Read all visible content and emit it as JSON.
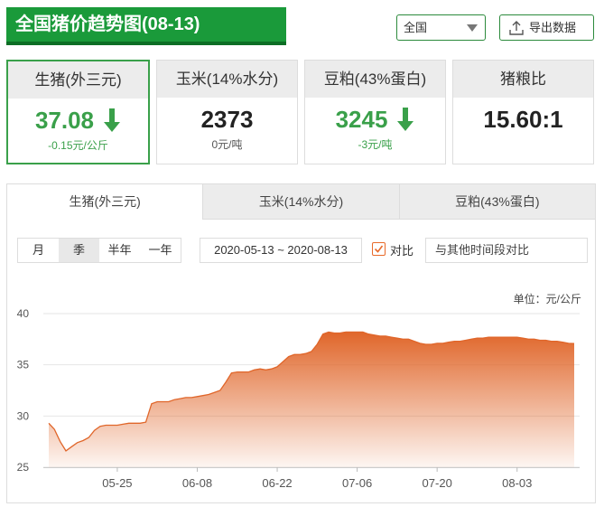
{
  "title": "全国猪价趋势图(08-13)",
  "region_select": {
    "value": "全国"
  },
  "export_button": {
    "label": "导出数据"
  },
  "cards": [
    {
      "name": "生猪(外三元)",
      "value": "37.08",
      "change": "-0.15元/公斤",
      "trend": "down",
      "active": true
    },
    {
      "name": "玉米(14%水分)",
      "value": "2373",
      "change": "0元/吨",
      "trend": "flat",
      "active": false
    },
    {
      "name": "豆粕(43%蛋白)",
      "value": "3245",
      "change": "-3元/吨",
      "trend": "down",
      "active": false
    },
    {
      "name": "猪粮比",
      "value": "15.60:1",
      "change": "",
      "trend": "none",
      "active": false
    }
  ],
  "tabs": [
    "生猪(外三元)",
    "玉米(14%水分)",
    "豆粕(43%蛋白)"
  ],
  "periods": [
    "月",
    "季",
    "半年",
    "一年"
  ],
  "active_period": "季",
  "date_range": "2020-05-13 ~ 2020-08-13",
  "compare": {
    "label": "对比",
    "checked": true,
    "placeholder": "与其他时间段对比"
  },
  "colors": {
    "green": "#3aa04a",
    "title_bg": "#1a9a3a",
    "series": "#e0662a"
  },
  "chart_data": {
    "type": "area",
    "unit_label": "单位：元/公斤",
    "ylim": [
      25,
      40
    ],
    "yticks": [
      25,
      30,
      35,
      40
    ],
    "grid": true,
    "xticks": [
      "05-25",
      "06-08",
      "06-22",
      "07-06",
      "07-20",
      "08-03"
    ],
    "x": [
      "05-13",
      "05-14",
      "05-15",
      "05-16",
      "05-17",
      "05-18",
      "05-19",
      "05-20",
      "05-21",
      "05-22",
      "05-23",
      "05-24",
      "05-25",
      "05-26",
      "05-27",
      "05-28",
      "05-29",
      "05-30",
      "05-31",
      "06-01",
      "06-02",
      "06-03",
      "06-04",
      "06-05",
      "06-06",
      "06-07",
      "06-08",
      "06-09",
      "06-10",
      "06-11",
      "06-12",
      "06-13",
      "06-14",
      "06-15",
      "06-16",
      "06-17",
      "06-18",
      "06-19",
      "06-20",
      "06-21",
      "06-22",
      "06-23",
      "06-24",
      "06-25",
      "06-26",
      "06-27",
      "06-28",
      "06-29",
      "06-30",
      "07-01",
      "07-02",
      "07-03",
      "07-04",
      "07-05",
      "07-06",
      "07-07",
      "07-08",
      "07-09",
      "07-10",
      "07-11",
      "07-12",
      "07-13",
      "07-14",
      "07-15",
      "07-16",
      "07-17",
      "07-18",
      "07-19",
      "07-20",
      "07-21",
      "07-22",
      "07-23",
      "07-24",
      "07-25",
      "07-26",
      "07-27",
      "07-28",
      "07-29",
      "07-30",
      "07-31",
      "08-01",
      "08-02",
      "08-03",
      "08-04",
      "08-05",
      "08-06",
      "08-07",
      "08-08",
      "08-09",
      "08-10",
      "08-11",
      "08-12",
      "08-13"
    ],
    "series": [
      {
        "name": "",
        "values": [
          29.3,
          28.7,
          27.5,
          26.6,
          27.0,
          27.4,
          27.6,
          27.9,
          28.6,
          29.0,
          29.1,
          29.1,
          29.1,
          29.2,
          29.3,
          29.3,
          29.3,
          29.4,
          31.2,
          31.4,
          31.4,
          31.4,
          31.6,
          31.7,
          31.8,
          31.8,
          31.9,
          32.0,
          32.1,
          32.3,
          32.5,
          33.3,
          34.2,
          34.3,
          34.3,
          34.3,
          34.5,
          34.6,
          34.5,
          34.6,
          34.8,
          35.3,
          35.8,
          36.0,
          36.0,
          36.1,
          36.3,
          37.0,
          38.0,
          38.2,
          38.1,
          38.1,
          38.2,
          38.2,
          38.2,
          38.2,
          38.0,
          37.9,
          37.8,
          37.8,
          37.7,
          37.6,
          37.5,
          37.5,
          37.3,
          37.1,
          37.0,
          37.0,
          37.1,
          37.1,
          37.2,
          37.3,
          37.3,
          37.4,
          37.5,
          37.6,
          37.6,
          37.7,
          37.7,
          37.7,
          37.7,
          37.7,
          37.7,
          37.6,
          37.5,
          37.5,
          37.4,
          37.4,
          37.3,
          37.3,
          37.2,
          37.1,
          37.08
        ]
      }
    ]
  }
}
